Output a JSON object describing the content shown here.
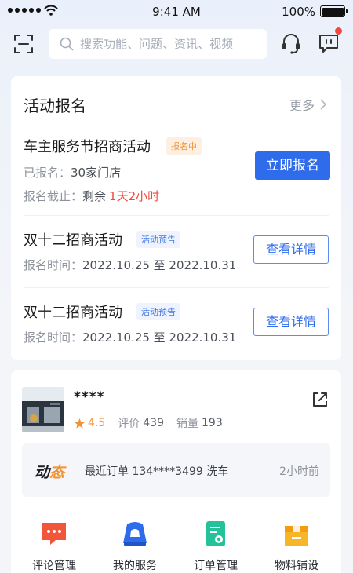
{
  "status_bar": {
    "time": "9:41 AM",
    "battery": "100%"
  },
  "header": {
    "search_placeholder": "搜索功能、问题、资讯、视频",
    "icons": [
      "scan-icon",
      "search-icon",
      "headset-icon",
      "message-icon"
    ]
  },
  "activity": {
    "title": "活动报名",
    "more_label": "更多",
    "items": [
      {
        "title": "车主服务节招商活动",
        "tag": "报名中",
        "line1_label": "已报名：",
        "line1_value": "30家门店",
        "line2_label": "报名截止：",
        "line2_mid": "剩余",
        "line2_value": "1天2小时",
        "button": "立即报名"
      },
      {
        "title": "双十二招商活动",
        "tag": "活动预告",
        "line_label": "报名时间：",
        "line_value": "2022.10.25 至 2022.10.31",
        "button": "查看详情"
      },
      {
        "title": "双十二招商活动",
        "tag": "活动预告",
        "line_label": "报名时间：",
        "line_value": "2022.10.25 至 2022.10.31",
        "button": "查看详情"
      }
    ]
  },
  "store": {
    "name": "****",
    "score": "4.5",
    "review_label": "评价",
    "review_count": "439",
    "sales_label": "销量",
    "sales_count": "193",
    "dynamic": {
      "logo_a": "动",
      "logo_b": "态",
      "text": "最近订单 134****3499 洗车",
      "time": "2小时前"
    }
  },
  "menu": [
    {
      "label": "评论管理",
      "icon": "comment-icon",
      "color": "#f2563a"
    },
    {
      "label": "我的服务",
      "icon": "car-service-icon",
      "color": "#2f6cec"
    },
    {
      "label": "订单管理",
      "icon": "order-icon",
      "color": "#23c29a"
    },
    {
      "label": "物料铺设",
      "icon": "materials-icon",
      "color": "#f7b528"
    }
  ],
  "colors": {
    "primary": "#2f6cec",
    "accent_orange": "#f39232",
    "alert_red": "#f0483c"
  }
}
